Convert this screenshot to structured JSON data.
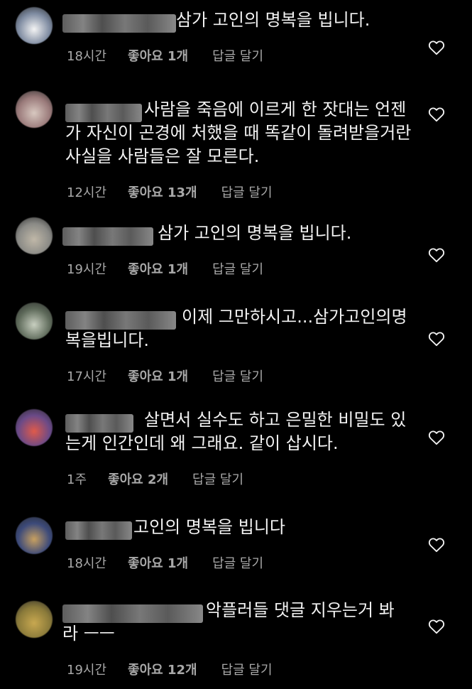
{
  "ui": {
    "reply_label": "답글 달기",
    "like_prefix": "좋아요",
    "accent_text": "#f2f2f2",
    "meta_color": "#a8a8a8"
  },
  "comments": [
    {
      "text_lines": [
        "삼가 고인의 명복을 빕니다."
      ],
      "time": "18시간",
      "likes": "좋아요 1개",
      "reply": "답글 달기",
      "avatar_colors": [
        "#7d8aa0",
        "#f4f4f4"
      ]
    },
    {
      "text_lines": [
        "사람을 죽음에 이르게 한 잣대는 언젠",
        "가 자신이 곤경에 처했을 때 똑같이 돌려받을거란",
        "사실을 사람들은 잘 모른다."
      ],
      "time": "12시간",
      "likes": "좋아요 13개",
      "reply": "답글 달기",
      "avatar_colors": [
        "#9a7a7a",
        "#d8c8c0"
      ]
    },
    {
      "text_lines": [
        "삼가 고인의 명복을 빕니다."
      ],
      "time": "19시간",
      "likes": "좋아요 1개",
      "reply": "답글 달기",
      "avatar_colors": [
        "#8a8a86",
        "#c0b8a8"
      ]
    },
    {
      "text_lines": [
        "이제 그만하시고...삼가고인의명",
        "복을빕니다."
      ],
      "time": "17시간",
      "likes": "좋아요 1개",
      "reply": "답글 달기",
      "avatar_colors": [
        "#5e6a5a",
        "#c8cfc0"
      ]
    },
    {
      "text_lines": [
        "살면서 실수도 하고 은밀한 비밀도 있",
        "는게 인간인데 왜 그래요. 같이 삽시다."
      ],
      "time": "1주",
      "likes": "좋아요 2개",
      "reply": "답글 달기",
      "avatar_colors": [
        "#6a4a88",
        "#e05a4a"
      ]
    },
    {
      "text_lines": [
        "고인의 명복을 빕니다"
      ],
      "time": "18시간",
      "likes": "좋아요 1개",
      "reply": "답글 달기",
      "avatar_colors": [
        "#3c4a7a",
        "#c8a060"
      ]
    },
    {
      "text_lines": [
        "악플러들 댓글 지우는거 봐",
        "라 ㅡㅡ"
      ],
      "time": "19시간",
      "likes": "좋아요 12개",
      "reply": "답글 달기",
      "avatar_colors": [
        "#8a7a3a",
        "#c8a850"
      ]
    }
  ]
}
